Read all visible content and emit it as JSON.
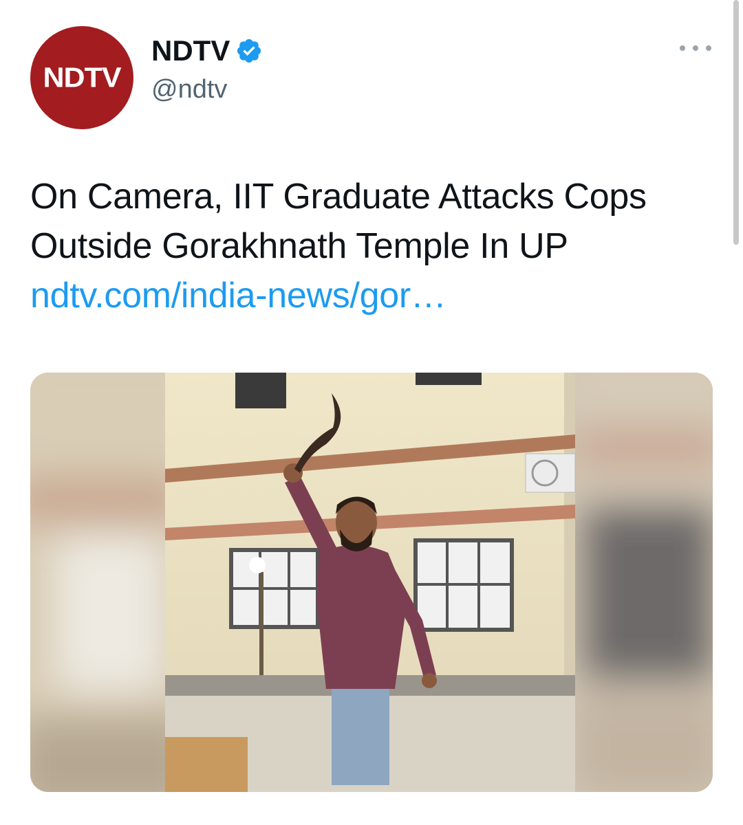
{
  "account": {
    "display_name": "NDTV",
    "handle": "@ndtv",
    "avatar_text": "NDTV",
    "verified": true
  },
  "tweet": {
    "text": "On Camera, IIT Graduate Attacks Cops Outside Gorakhnath Temple In UP",
    "link_text": "ndtv.com/india-news/gor…"
  },
  "icons": {
    "verified": "verified-badge-icon",
    "more": "more-options-icon"
  },
  "colors": {
    "avatar_bg": "#a31c1f",
    "link": "#1d9bf0",
    "verified": "#1d9bf0",
    "handle": "#536471"
  }
}
